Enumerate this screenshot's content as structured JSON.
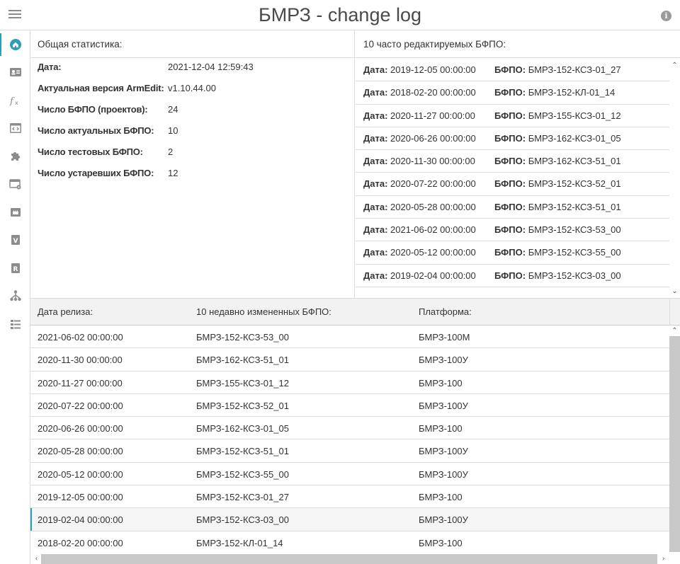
{
  "app": {
    "title": "БМРЗ - change log"
  },
  "colors": {
    "accent": "#2a9fb5",
    "sidebar_icon": "#8c8c8c"
  },
  "sidebar": {
    "items": [
      {
        "icon": "home-icon",
        "active": true
      },
      {
        "icon": "id-card-icon",
        "active": false
      },
      {
        "icon": "function-icon",
        "active": false
      },
      {
        "icon": "code-window-icon",
        "active": false
      },
      {
        "icon": "puzzle-icon",
        "active": false
      },
      {
        "icon": "window-settings-icon",
        "active": false
      },
      {
        "icon": "network-port-icon",
        "active": false
      },
      {
        "icon": "v-badge-icon",
        "active": false
      },
      {
        "icon": "r-badge-icon",
        "active": false
      },
      {
        "icon": "hierarchy-icon",
        "active": false
      },
      {
        "icon": "list-icon",
        "active": false
      }
    ]
  },
  "stats": {
    "title": "Общая статистика:",
    "rows": [
      {
        "label": "Дата:",
        "value": "2021-12-04 12:59:43"
      },
      {
        "label": "Актуальная версия ArmEdit:",
        "value": "v1.10.44.00"
      },
      {
        "label": "Число БФПО (проектов):",
        "value": "24"
      },
      {
        "label": "Число актуальных БФПО:",
        "value": "10"
      },
      {
        "label": "Число тестовых БФПО:",
        "value": "2"
      },
      {
        "label": "Число устаревших БФПО:",
        "value": "12"
      }
    ]
  },
  "frequent": {
    "title": "10 часто редактируемых БФПО:",
    "date_label": "Дата:",
    "bfpo_label": "БФПО:",
    "rows": [
      {
        "date": "2019-12-05 00:00:00",
        "bfpo": "БМРЗ-152-КСЗ-01_27"
      },
      {
        "date": "2018-02-20 00:00:00",
        "bfpo": "БМРЗ-152-КЛ-01_14"
      },
      {
        "date": "2020-11-27 00:00:00",
        "bfpo": "БМРЗ-155-КСЗ-01_12"
      },
      {
        "date": "2020-06-26 00:00:00",
        "bfpo": "БМРЗ-162-КСЗ-01_05"
      },
      {
        "date": "2020-11-30 00:00:00",
        "bfpo": "БМРЗ-162-КСЗ-51_01"
      },
      {
        "date": "2020-07-22 00:00:00",
        "bfpo": "БМРЗ-152-КСЗ-52_01"
      },
      {
        "date": "2020-05-28 00:00:00",
        "bfpo": "БМРЗ-152-КСЗ-51_01"
      },
      {
        "date": "2021-06-02 00:00:00",
        "bfpo": "БМРЗ-152-КСЗ-53_00"
      },
      {
        "date": "2020-05-12 00:00:00",
        "bfpo": "БМРЗ-152-КСЗ-55_00"
      },
      {
        "date": "2019-02-04 00:00:00",
        "bfpo": "БМРЗ-152-КСЗ-03_00"
      }
    ]
  },
  "recent": {
    "columns": [
      "Дата релиза:",
      "10 недавно измененных БФПО:",
      "Платформа:"
    ],
    "selected_index": 8,
    "rows": [
      {
        "date": "2021-06-02 00:00:00",
        "bfpo": "БМРЗ-152-КСЗ-53_00",
        "platform": "БМРЗ-100М"
      },
      {
        "date": "2020-11-30 00:00:00",
        "bfpo": "БМРЗ-162-КСЗ-51_01",
        "platform": "БМРЗ-100У"
      },
      {
        "date": "2020-11-27 00:00:00",
        "bfpo": "БМРЗ-155-КСЗ-01_12",
        "platform": "БМРЗ-100"
      },
      {
        "date": "2020-07-22 00:00:00",
        "bfpo": "БМРЗ-152-КСЗ-52_01",
        "platform": "БМРЗ-100У"
      },
      {
        "date": "2020-06-26 00:00:00",
        "bfpo": "БМРЗ-162-КСЗ-01_05",
        "platform": "БМРЗ-100"
      },
      {
        "date": "2020-05-28 00:00:00",
        "bfpo": "БМРЗ-152-КСЗ-51_01",
        "platform": "БМРЗ-100У"
      },
      {
        "date": "2020-05-12 00:00:00",
        "bfpo": "БМРЗ-152-КСЗ-55_00",
        "platform": "БМРЗ-100У"
      },
      {
        "date": "2019-12-05 00:00:00",
        "bfpo": "БМРЗ-152-КСЗ-01_27",
        "platform": "БМРЗ-100"
      },
      {
        "date": "2019-02-04 00:00:00",
        "bfpo": "БМРЗ-152-КСЗ-03_00",
        "platform": "БМРЗ-100У"
      },
      {
        "date": "2018-02-20 00:00:00",
        "bfpo": "БМРЗ-152-КЛ-01_14",
        "platform": "БМРЗ-100"
      }
    ]
  }
}
